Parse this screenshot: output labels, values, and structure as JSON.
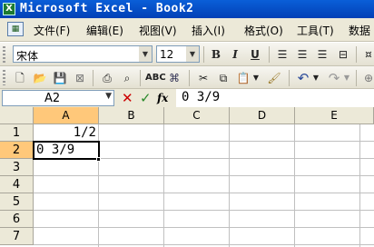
{
  "window": {
    "title": "Microsoft Excel - Book2",
    "app_icon": "excel-icon"
  },
  "menu": [
    "文件(F)",
    "编辑(E)",
    "视图(V)",
    "插入(I)",
    "格式(O)",
    "工具(T)",
    "数据"
  ],
  "formatting": {
    "font": "宋体",
    "size": "12",
    "bold": "B",
    "italic": "I",
    "underline": "U"
  },
  "formula_bar": {
    "name_box": "A2",
    "cancel": "✕",
    "enter": "✓",
    "fx": "fx",
    "value": "0 3/9"
  },
  "columns": [
    "A",
    "B",
    "C",
    "D",
    "E"
  ],
  "rows": [
    "1",
    "2",
    "3",
    "4",
    "5",
    "6",
    "7"
  ],
  "cells": {
    "A1": "1/2",
    "A2": "0 3/9"
  },
  "colors": {
    "title_bar": "#0a5fd8",
    "active_header": "#ffc87a",
    "cancel": "#cc0000",
    "enter": "#2a8a2a"
  }
}
